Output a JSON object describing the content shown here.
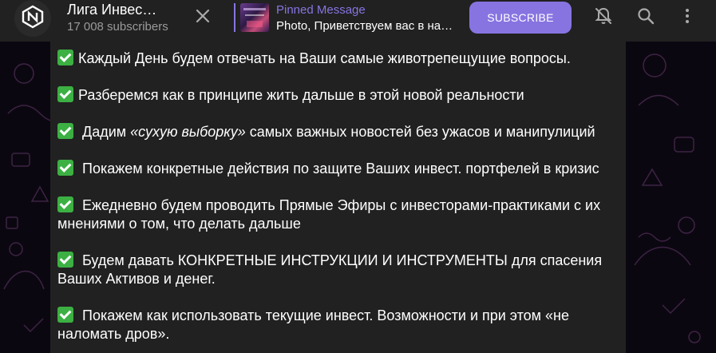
{
  "header": {
    "channel_title": "Лига Инвес…",
    "subscribers": "17 008 subscribers",
    "pinned_label": "Pinned Message",
    "pinned_text": "Photo, Приветствуем вас в на…",
    "subscribe_label": "SUBSCRIBE"
  },
  "message": {
    "paragraphs": [
      {
        "before": "Каждый День будем отвечать на Ваши самые животрепещущие вопросы.",
        "emph": "",
        "after": ""
      },
      {
        "before": "Разберемся как в принципе жить дальше в этой новой реальности",
        "emph": "",
        "after": ""
      },
      {
        "before": " Дадим ",
        "emph": "«сухую выборку»",
        "after": " самых важных новостей без ужасов и манипулиций"
      },
      {
        "before": " Покажем конкретные действия по защите Ваших инвест. портфелей в кризис",
        "emph": "",
        "after": ""
      },
      {
        "before": " Ежедневно будем проводить Прямые Эфиры с инвесторами-практиками с их мнениями о том, что делать дальше",
        "emph": "",
        "after": ""
      },
      {
        "before": " Будем давать КОНКРЕТНЫЕ ИНСТРУКЦИИ И ИНСТРУМЕНТЫ для спасения Ваших Активов и денег.",
        "emph": "",
        "after": ""
      },
      {
        "before": " Покажем как использовать текущие инвест. Возможности  и при этом «не наломать дров».",
        "emph": "",
        "after": ""
      }
    ]
  },
  "icons": {
    "avatar": "channel-logo-icon",
    "close": "close-icon",
    "mute": "bell-off-icon",
    "search": "search-icon",
    "more": "more-vertical-icon",
    "check": "check-mark-emoji-icon"
  },
  "colors": {
    "accent": "#8774e1",
    "header_bg": "#212121",
    "message_bg": "#212121",
    "check_green": "#3cb043"
  }
}
